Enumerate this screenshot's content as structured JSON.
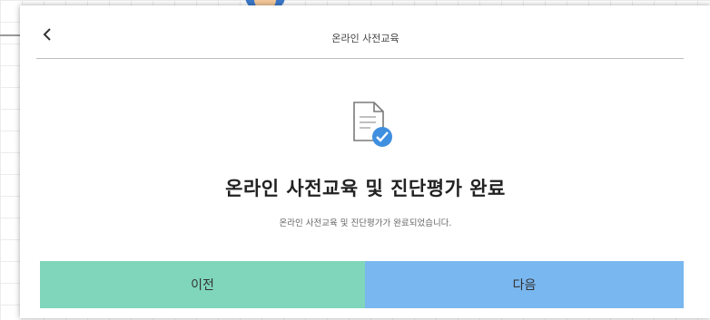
{
  "header": {
    "title": "온라인 사전교육",
    "back_icon": "chevron-left-icon"
  },
  "status": {
    "icon": "document-check-icon",
    "title": "온라인 사전교육 및 진단평가 완료",
    "message": "온라인 사전교육 및 진단평가가 완료되었습니다."
  },
  "buttons": {
    "prev_label": "이전",
    "next_label": "다음"
  },
  "colors": {
    "prev_button": "#7fd6ba",
    "next_button": "#79b7f0",
    "check_badge": "#3f8fe0"
  }
}
